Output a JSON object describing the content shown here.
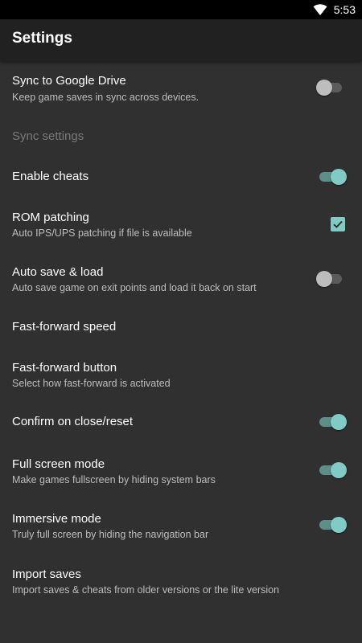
{
  "status_bar": {
    "time": "5:53",
    "icons": [
      "wifi-icon"
    ]
  },
  "app_bar": {
    "title": "Settings"
  },
  "colors": {
    "accent": "#80cbc4",
    "background": "#303030",
    "app_bar": "#212121",
    "status_bar": "#000000"
  },
  "settings": {
    "sync_drive": {
      "title": "Sync to Google Drive",
      "summary": "Keep game saves in sync across devices.",
      "enabled": false
    },
    "sync_settings": {
      "title": "Sync settings",
      "disabled": true
    },
    "enable_cheats": {
      "title": "Enable cheats",
      "enabled": true
    },
    "rom_patching": {
      "title": "ROM patching",
      "summary": "Auto IPS/UPS patching if file is available",
      "checked": true
    },
    "auto_save": {
      "title": "Auto save & load",
      "summary": "Auto save game on exit points and load it back on start",
      "enabled": false
    },
    "ff_speed": {
      "title": "Fast-forward speed"
    },
    "ff_button": {
      "title": "Fast-forward button",
      "summary": "Select how fast-forward is activated"
    },
    "confirm_close": {
      "title": "Confirm on close/reset",
      "enabled": true
    },
    "full_screen": {
      "title": "Full screen mode",
      "summary": "Make games fullscreen by hiding system bars",
      "enabled": true
    },
    "immersive": {
      "title": "Immersive mode",
      "summary": "Truly full screen by hiding the navigation bar",
      "enabled": true
    },
    "import_saves": {
      "title": "Import saves",
      "summary": "Import saves & cheats from older versions or the lite version"
    }
  }
}
